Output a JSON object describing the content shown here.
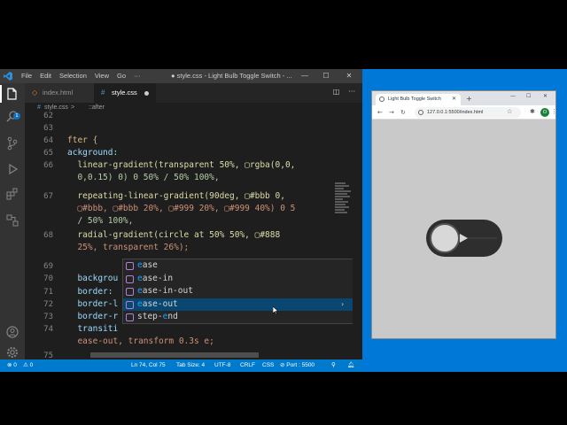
{
  "vscode": {
    "menu": [
      "File",
      "Edit",
      "Selection",
      "View",
      "Go",
      "···"
    ],
    "window_title": "● style.css - Light Bulb Toggle Switch - ...",
    "window_controls": [
      "—",
      "☐",
      "✕"
    ],
    "activity_badge": "1",
    "tabs": [
      {
        "label": "index.html",
        "icon": "html-file-icon"
      },
      {
        "label": "style.css",
        "icon": "css-file-icon",
        "modified": true
      }
    ],
    "breadcrumb": {
      "file": "style.css",
      "separator": ">",
      "symbol": "::after"
    },
    "lines": [
      {
        "num": "62",
        "code": ""
      },
      {
        "num": "63",
        "code": ""
      },
      {
        "num": "64",
        "code": "fter {"
      },
      {
        "num": "65",
        "code": "ackground:"
      },
      {
        "num": "66",
        "code": "  linear-gradient(transparent 50%, ▢rgba(0,0,"
      },
      {
        "num": "",
        "code": "  0,0.15) 0) 0 50% / 50% 100%,"
      },
      {
        "num": "67",
        "code": "  repeating-linear-gradient(90deg, ▢#bbb 0,"
      },
      {
        "num": "",
        "code": "  ▢#bbb, ▢#bbb 20%, ▢#999 20%, ▢#999 40%) 0 5"
      },
      {
        "num": "",
        "code": "  / 50% 100%,"
      },
      {
        "num": "68",
        "code": "  radial-gradient(circle at 50% 50%, ▢#888"
      },
      {
        "num": "",
        "code": "  25%, transparent 26%);"
      },
      {
        "num": "69",
        "code": ""
      },
      {
        "num": "70",
        "code": "  backgrou"
      },
      {
        "num": "71",
        "code": "  border: "
      },
      {
        "num": "72",
        "code": "  border-l"
      },
      {
        "num": "73",
        "code": "  border-r"
      },
      {
        "num": "74",
        "code": "  transiti"
      },
      {
        "num": "",
        "code": "  ease-out, transform 0.3s e;"
      },
      {
        "num": "75",
        "code": ""
      }
    ],
    "suggestions": [
      {
        "label": "ease",
        "match": "e",
        "rest": "ase"
      },
      {
        "label": "ease-in",
        "match": "e",
        "rest": "ase-in"
      },
      {
        "label": "ease-in-out",
        "match": "e",
        "rest": "ase-in-out"
      },
      {
        "label": "ease-out",
        "match": "e",
        "rest": "ase-out",
        "active": true
      },
      {
        "label": "step-end",
        "match": "",
        "rest": "step-",
        "tail": "e",
        "tail2": "nd"
      }
    ],
    "status": {
      "errors": "⊗ 0",
      "warnings": "⚠ 0",
      "position": "Ln 74, Col 75",
      "tab_size": "Tab Size: 4",
      "encoding": "UTF-8",
      "eol": "CRLF",
      "language": "CSS",
      "port": "⊘ Port : 5500"
    }
  },
  "browser": {
    "tab_title": "Light Bulb Toggle Switch",
    "url": "127.0.0.1:5500/index.html",
    "avatar": "O",
    "new_tab": "+",
    "window_controls": [
      "—",
      "☐",
      "✕"
    ],
    "toggle_colors": {
      "track": "#2e2e2e",
      "knob": "#d8d8d8"
    }
  }
}
